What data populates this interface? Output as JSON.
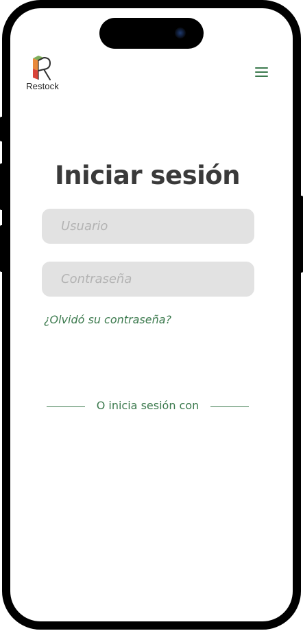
{
  "header": {
    "logo_text": "Restock",
    "menu_icon": "hamburger-menu-icon"
  },
  "login": {
    "title": "Iniciar sesión",
    "username_placeholder": "Usuario",
    "password_placeholder": "Contraseña",
    "forgot_password": "¿Olvidó su contraseña?",
    "divider_text": "O inicia sesión con"
  },
  "colors": {
    "accent": "#3c7a4e",
    "title": "#3a3a3a",
    "field_bg": "#e2e2e2",
    "placeholder": "#b3b3b3"
  }
}
